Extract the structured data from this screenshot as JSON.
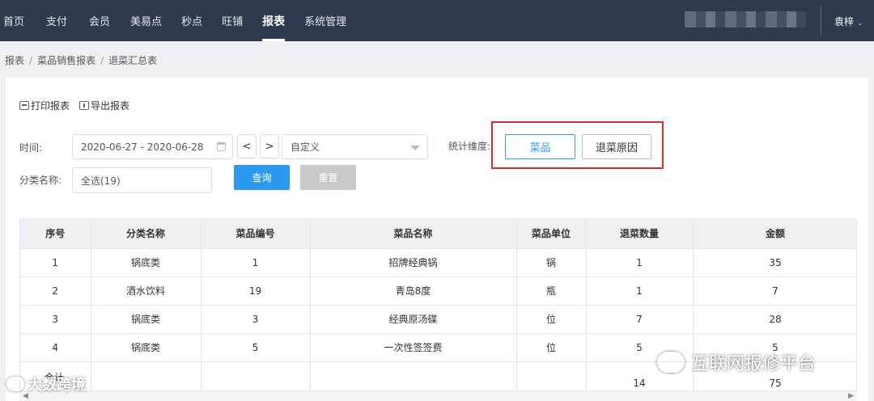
{
  "nav": {
    "items": [
      {
        "label": "首页",
        "active": false
      },
      {
        "label": "支付",
        "active": false
      },
      {
        "label": "会员",
        "active": false
      },
      {
        "label": "美易点",
        "active": false
      },
      {
        "label": "秒点",
        "active": false
      },
      {
        "label": "旺铺",
        "active": false
      },
      {
        "label": "报表",
        "active": true
      },
      {
        "label": "系统管理",
        "active": false
      }
    ],
    "user": "袁梓"
  },
  "breadcrumb": [
    "报表",
    "菜品销售报表",
    "退菜汇总表"
  ],
  "toolbar": {
    "print_label": "打印报表",
    "export_label": "导出报表"
  },
  "filters": {
    "time_label": "时间:",
    "date_range": "2020-06-27 - 2020-06-28",
    "prev_label": "<",
    "next_label": ">",
    "period_value": "自定义",
    "dimension_label": "统计维度:",
    "dimension_options": [
      {
        "label": "菜品",
        "active": true
      },
      {
        "label": "退菜原因",
        "active": false
      }
    ],
    "category_label": "分类名称:",
    "category_value": "全选(19)",
    "query_label": "查询",
    "reset_label": "重置"
  },
  "table": {
    "headers": [
      "序号",
      "分类名称",
      "菜品编号",
      "菜品名称",
      "菜品单位",
      "退菜数量",
      "金额"
    ],
    "rows": [
      [
        "1",
        "锅底类",
        "1",
        "招牌经典锅",
        "锅",
        "1",
        "35"
      ],
      [
        "2",
        "酒水饮料",
        "19",
        "青岛8度",
        "瓶",
        "1",
        "7"
      ],
      [
        "3",
        "锅底类",
        "3",
        "经典原汤碟",
        "位",
        "7",
        "28"
      ],
      [
        "4",
        "锅底类",
        "5",
        "一次性签签费",
        "位",
        "5",
        "5"
      ]
    ],
    "total": {
      "label": "合计",
      "quantity": "14",
      "amount": "75"
    }
  },
  "watermarks": {
    "left": "大数跨境",
    "right": "互联网报修平台"
  },
  "colors": {
    "nav_bg": "#2f3a4e",
    "primary": "#2d9af0",
    "highlight_box": "#e0292d"
  }
}
